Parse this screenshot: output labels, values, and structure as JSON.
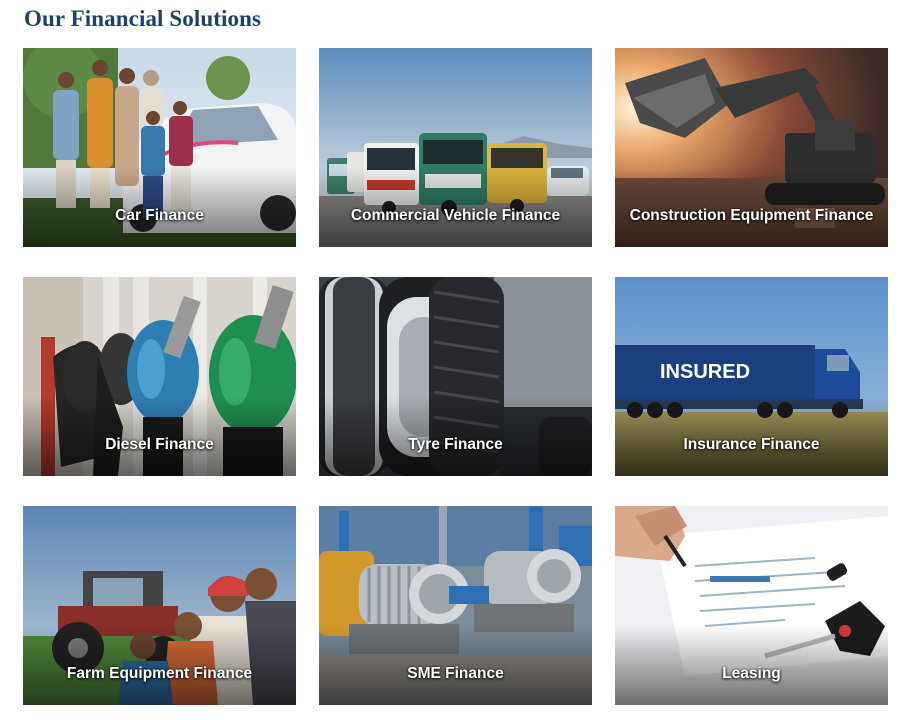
{
  "section": {
    "title": "Our Financial Solutions"
  },
  "products": [
    {
      "label": "Car Finance",
      "image": "family-with-white-car"
    },
    {
      "label": "Commercial Vehicle Finance",
      "image": "trucks-on-road"
    },
    {
      "label": "Construction Equipment Finance",
      "image": "excavator-at-sunset"
    },
    {
      "label": "Diesel Finance",
      "image": "fuel-pump-nozzles"
    },
    {
      "label": "Tyre Finance",
      "image": "truck-tyres"
    },
    {
      "label": "Insurance Finance",
      "image": "insured-truck"
    },
    {
      "label": "Farm Equipment Finance",
      "image": "farmer-family-with-tractor"
    },
    {
      "label": "SME Finance",
      "image": "industrial-motors"
    },
    {
      "label": "Leasing",
      "image": "signing-document-with-key"
    }
  ],
  "insurance_truck_text": "INSURED",
  "colors": {
    "title": "#1f3f6e",
    "label_text": "#ffffff"
  }
}
